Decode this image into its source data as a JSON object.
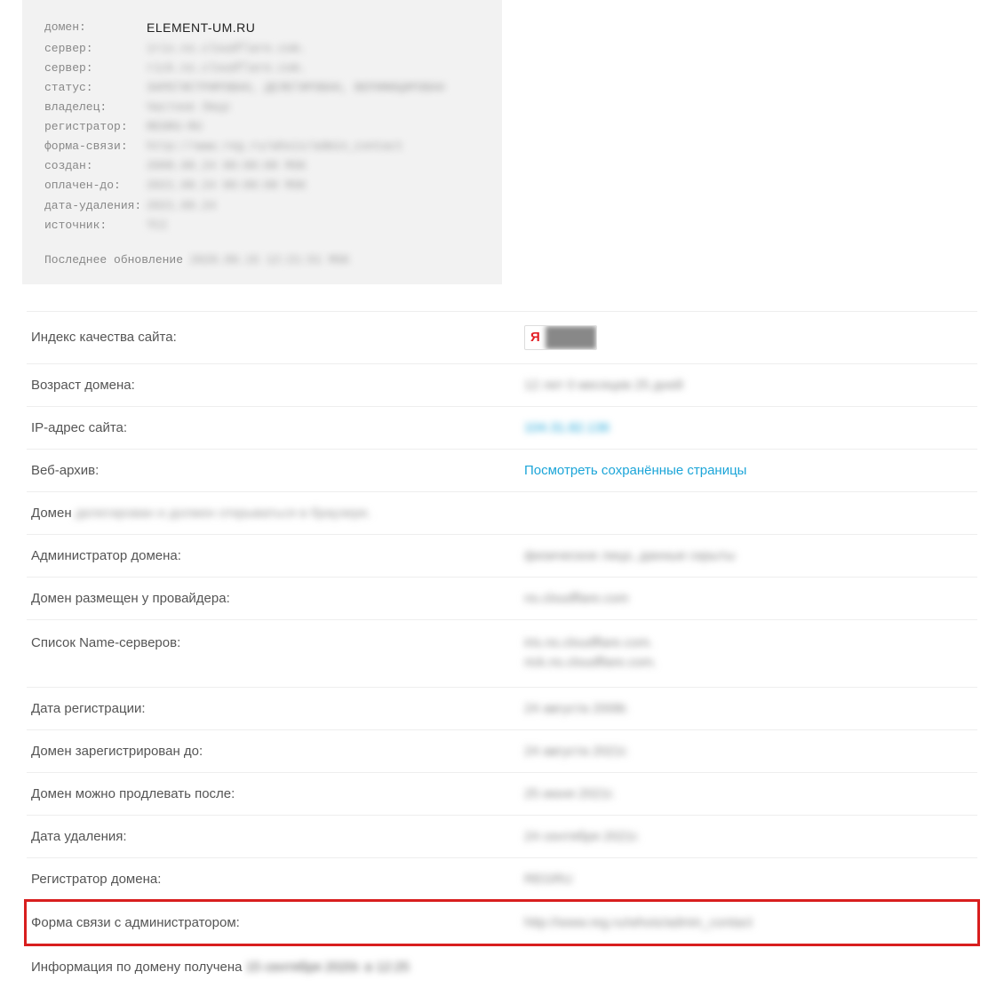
{
  "whois": {
    "labels": {
      "domain": "домен:",
      "server1": "сервер:",
      "server2": "сервер:",
      "status": "статус:",
      "owner": "владелец:",
      "registrar": "регистратор:",
      "contact_form": "форма-связи:",
      "created": "создан:",
      "paid_till": "оплачен-до:",
      "delete_date": "дата-удаления:",
      "source": "источник:"
    },
    "values": {
      "domain": "ELEMENT-UM.RU",
      "server1": "iris.ns.cloudflare.com.",
      "server2": "rick.ns.cloudflare.com.",
      "status": "ЗАРЕГИСТРИРОВАН, ДЕЛЕГИРОВАН, ВЕРИФИЦИРОВАН",
      "owner": "Частное Лицо",
      "registrar": "REGRU-RU",
      "contact_form": "http://www.reg.ru/whois/admin_contact",
      "created": "2008.08.24 00:00:00 MSK",
      "paid_till": "2021.08.24 00:00:00 MSK",
      "delete_date": "2021.09.24",
      "source": "TCI"
    },
    "footer_prefix": "Последнее обновление ",
    "footer_time": "2020.09.15 12:21:51 MSK"
  },
  "details": {
    "quality_label": "Индекс качества сайта:",
    "quality_badge_left": "Я",
    "quality_badge_right": "120",
    "age_label": "Возраст домена:",
    "age_value": "12 лет 0 месяцев 25 дней",
    "ip_label": "IP-адрес сайта:",
    "ip_value": "104.31.82.136",
    "archive_label": "Веб-архив:",
    "archive_link": "Посмотреть сохранённые страницы",
    "domain_status_prefix": "Домен ",
    "domain_status_suffix": "делегирован и должен открываться в браузере.",
    "admin_label": "Администратор домена:",
    "admin_value": "физическое лицо, данные скрыты",
    "provider_label": "Домен размещен у провайдера:",
    "provider_value": "ns.cloudflare.com",
    "ns_label": "Список Name-серверов:",
    "ns_value1": "iris.ns.cloudflare.com.",
    "ns_value2": "rick.ns.cloudflare.com.",
    "reg_date_label": "Дата регистрации:",
    "reg_date_value": "24 августа 2008г.",
    "reg_until_label": "Домен зарегистрирован до:",
    "reg_until_value": "24 августа 2021г.",
    "renew_label": "Домен можно продлевать после:",
    "renew_value": "25 июня 2021г.",
    "delete_label": "Дата удаления:",
    "delete_value": "24 сентября 2021г.",
    "registrar_label": "Регистратор домена:",
    "registrar_value": "REGRU",
    "contact_label": "Форма связи с администратором:",
    "contact_value": "http://www.reg.ru/whois/admin_contact",
    "info_prefix": "Информация по домену получена ",
    "info_date": "15 сентября 2020г. в 12:25"
  }
}
